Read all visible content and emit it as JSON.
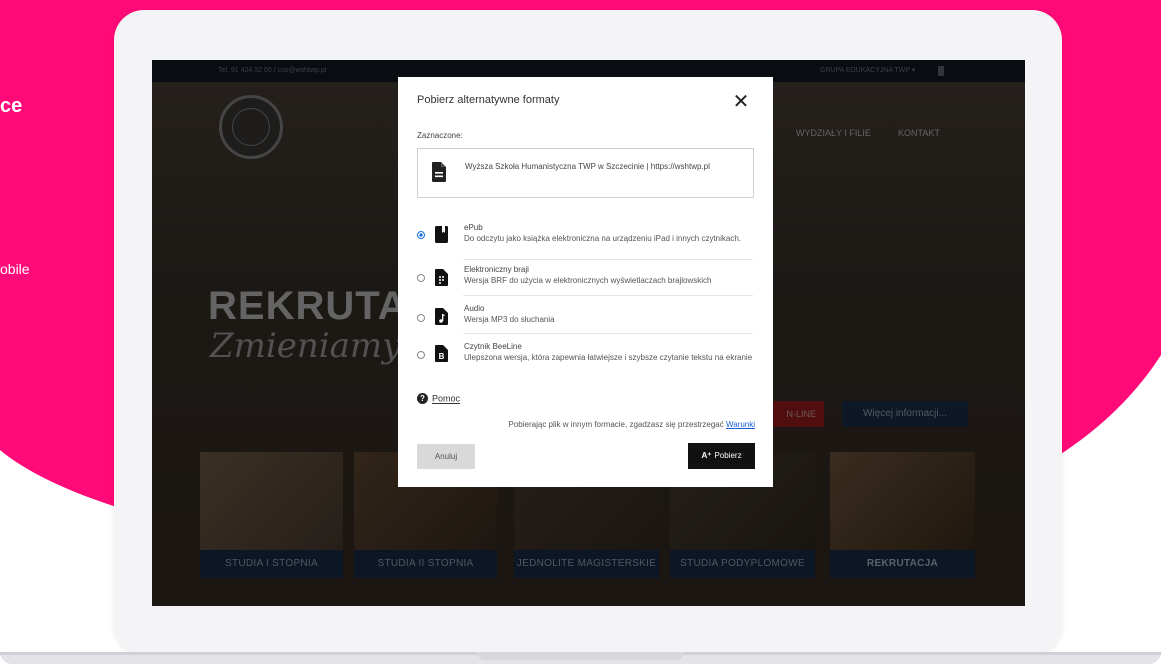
{
  "side": {
    "line1": "ce",
    "line2": "obile"
  },
  "site": {
    "topbar_left": "Tel. 91 424 32 00  /   cos@wshtwp.pl",
    "topbar_right": "GRUPA EDUKACYJNA TWP  ▾",
    "nav": [
      "WYDZIAŁY I FILIE",
      "KONTAKT"
    ],
    "hero_title": "REKRUTAC",
    "hero_subtitle": "Zmieniamy ob",
    "online_btn": "N-LINE",
    "more_btn": "Więcej informacji...",
    "tiles": [
      "STUDIA I STOPNIA",
      "STUDIA II STOPNIA",
      "JEDNOLITE MAGISTERSKIE",
      "STUDIA PODYPLOMOWE",
      "REKRUTACJA"
    ]
  },
  "modal": {
    "title": "Pobierz alternatywne formaty",
    "selected_label": "Zaznaczone:",
    "file_name": "Wyższa Szkoła Humanistyczna TWP w Szczecinie | https://wshtwp.pl",
    "options": [
      {
        "name": "ePub",
        "desc": "Do odczytu jako książka elektroniczna na urządzeniu iPad i innych czytnikach.",
        "selected": true,
        "icon": "book-icon"
      },
      {
        "name": "Elektroniczny braji",
        "desc": "Wersja BRF do użycia w elektronicznych wyświetlaczach brajlowskich",
        "selected": false,
        "icon": "braille-icon"
      },
      {
        "name": "Audio",
        "desc": "Wersja MP3 do słuchania",
        "selected": false,
        "icon": "audio-file-icon"
      },
      {
        "name": "Czytnik BeeLine",
        "desc": "Ulepszona wersja, która zapewnia łatwiejsze i szybsze czytanie tekstu na ekranie",
        "selected": false,
        "icon": "beeline-file-icon"
      }
    ],
    "help_label": "Pomoc",
    "terms_text": "Pobierając plik w innym formacie, zgadzasz się przestrzegać",
    "terms_link": "Warunki",
    "cancel_label": "Anuluj",
    "download_label": "Pobierz"
  },
  "colors": {
    "brand_pink": "#ff0a78",
    "primary_button": "#111111",
    "radio_selected": "#1a73e8"
  }
}
